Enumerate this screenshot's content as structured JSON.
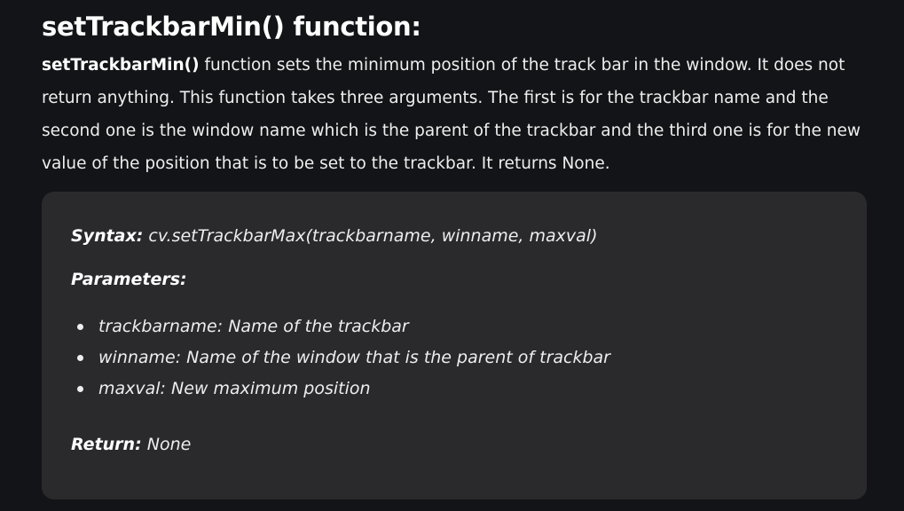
{
  "heading": "setTrackbarMin() function:",
  "paragraph": {
    "function_name": "setTrackbarMin()",
    "text": " function sets the minimum position of the track bar in the window. It does not return anything. This function takes three arguments. The first is for the trackbar name and the second one is the window name which is the parent of the trackbar and the third one is for the new value of the position that is to be set to the trackbar. It returns None."
  },
  "box": {
    "syntax_label": "Syntax:",
    "syntax_value": " cv.setTrackbarMax(trackbarname, winname, maxval)",
    "parameters_label": "Parameters:",
    "parameters": [
      "trackbarname: Name of the trackbar",
      "winname: Name of the window that is the parent of trackbar",
      "maxval: New maximum position"
    ],
    "return_label": "Return:",
    "return_value": " None"
  }
}
